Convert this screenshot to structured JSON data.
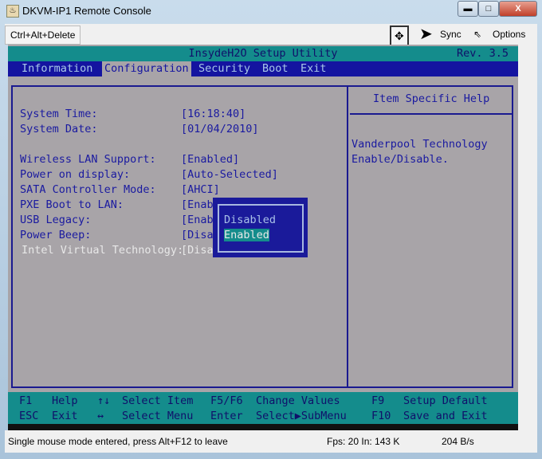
{
  "window": {
    "title": "DKVM-IP1 Remote Console",
    "minimize": "▬",
    "maximize": "□",
    "close": "X"
  },
  "toolbar": {
    "ctrl_alt_del": "Ctrl+Alt+Delete",
    "sync": "Sync",
    "options": "Options"
  },
  "bios": {
    "title": "InsydeH2O Setup Utility",
    "rev": "Rev. 3.5",
    "menu": [
      "Information",
      "Configuration",
      "Security",
      "Boot",
      "Exit"
    ],
    "active_menu": "Configuration",
    "items": [
      {
        "label": "System Time:",
        "value": "[16:18:40]"
      },
      {
        "label": "System Date:",
        "value": "[01/04/2010]"
      },
      {
        "label": "Wireless LAN Support:",
        "value": "[Enabled]"
      },
      {
        "label": "Power on display:",
        "value": "[Auto-Selected]"
      },
      {
        "label": "SATA Controller Mode:",
        "value": "[AHCI]"
      },
      {
        "label": "PXE Boot to LAN:",
        "value": "[Enab"
      },
      {
        "label": "USB Legacy:",
        "value": "[Enab"
      },
      {
        "label": "Power Beep:",
        "value": "[Disa"
      },
      {
        "label": "Intel Virtual Technology:",
        "value": "[Disa"
      }
    ],
    "help_title": "Item Specific Help",
    "help_lines": [
      "Vanderpool Technology",
      "Enable/Disable."
    ],
    "popup": {
      "options": [
        "Disabled",
        "Enabled"
      ],
      "selected": "Enabled"
    },
    "footer": [
      [
        "F1",
        "Help",
        "↑↓",
        "Select Item",
        "F5/F6",
        "Change Values",
        "F9",
        "Setup Default"
      ],
      [
        "ESC",
        "Exit",
        "↔",
        "Select Menu",
        "Enter",
        "Select▶SubMenu",
        "F10",
        "Save and Exit"
      ]
    ]
  },
  "status": {
    "message": "Single mouse mode entered, press Alt+F12 to leave",
    "stats": "Fps: 20 In: 143 K",
    "stats2": "204 B/s"
  },
  "colors": {
    "bios_bg": "#a8a4a8",
    "bios_teal": "#148c8c",
    "bios_blue": "#1414a0"
  }
}
